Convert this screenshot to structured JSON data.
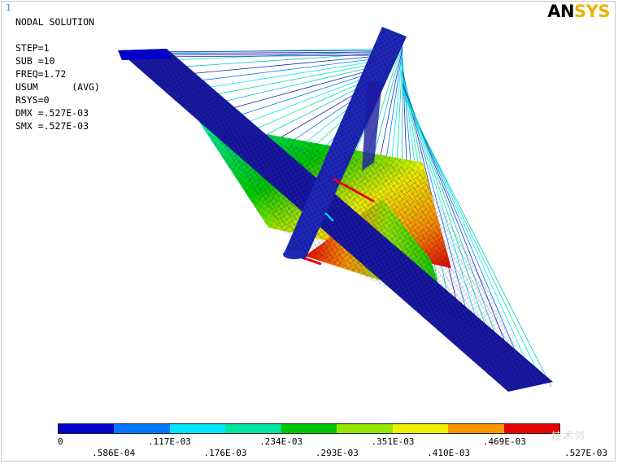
{
  "window_number": "1",
  "logo": {
    "an": "AN",
    "sys": "SYS"
  },
  "info_lines": [
    "NODAL SOLUTION",
    "",
    "STEP=1",
    "SUB =10",
    "FREQ=1.72",
    "USUM      (AVG)",
    "RSYS=0",
    "DMX =.527E-03",
    "SMX =.527E-03"
  ],
  "legend": {
    "colors": [
      "#0000c8",
      "#0078ff",
      "#00e6ff",
      "#00e6a0",
      "#00c800",
      "#96e600",
      "#f0f000",
      "#ff9600",
      "#e60000"
    ],
    "labels": [
      "0",
      ".586E-04",
      ".117E-03",
      ".176E-03",
      ".234E-03",
      ".293E-03",
      ".351E-03",
      ".410E-03",
      ".469E-03",
      ".527E-03"
    ]
  },
  "watermark": "技术邻"
}
